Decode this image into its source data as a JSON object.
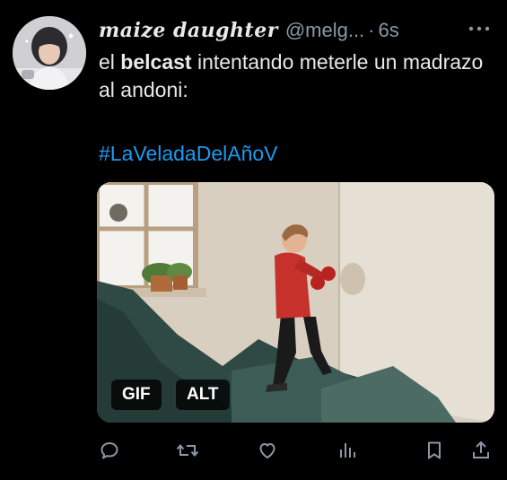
{
  "author": {
    "display_name": "maize daughter",
    "handle": "@melg...",
    "separator": "·",
    "time": "6s"
  },
  "tweet": {
    "text_before": "el ",
    "text_bold": "belcast",
    "text_after": " intentando meterle un madrazo al andoni:",
    "hashtag": "#LaVeladaDelAñoV"
  },
  "media": {
    "gif_label": "GIF",
    "alt_label": "ALT"
  },
  "actions": [
    {
      "name": "reply",
      "icon": "reply-icon"
    },
    {
      "name": "retweet",
      "icon": "retweet-icon"
    },
    {
      "name": "like",
      "icon": "heart-icon"
    },
    {
      "name": "views",
      "icon": "views-icon"
    },
    {
      "name": "bookmark",
      "icon": "bookmark-icon"
    },
    {
      "name": "share",
      "icon": "share-icon"
    }
  ],
  "colors": {
    "background": "#000000",
    "text": "#e7e9ea",
    "secondary": "#8b98a5",
    "link": "#1d9bf0"
  }
}
